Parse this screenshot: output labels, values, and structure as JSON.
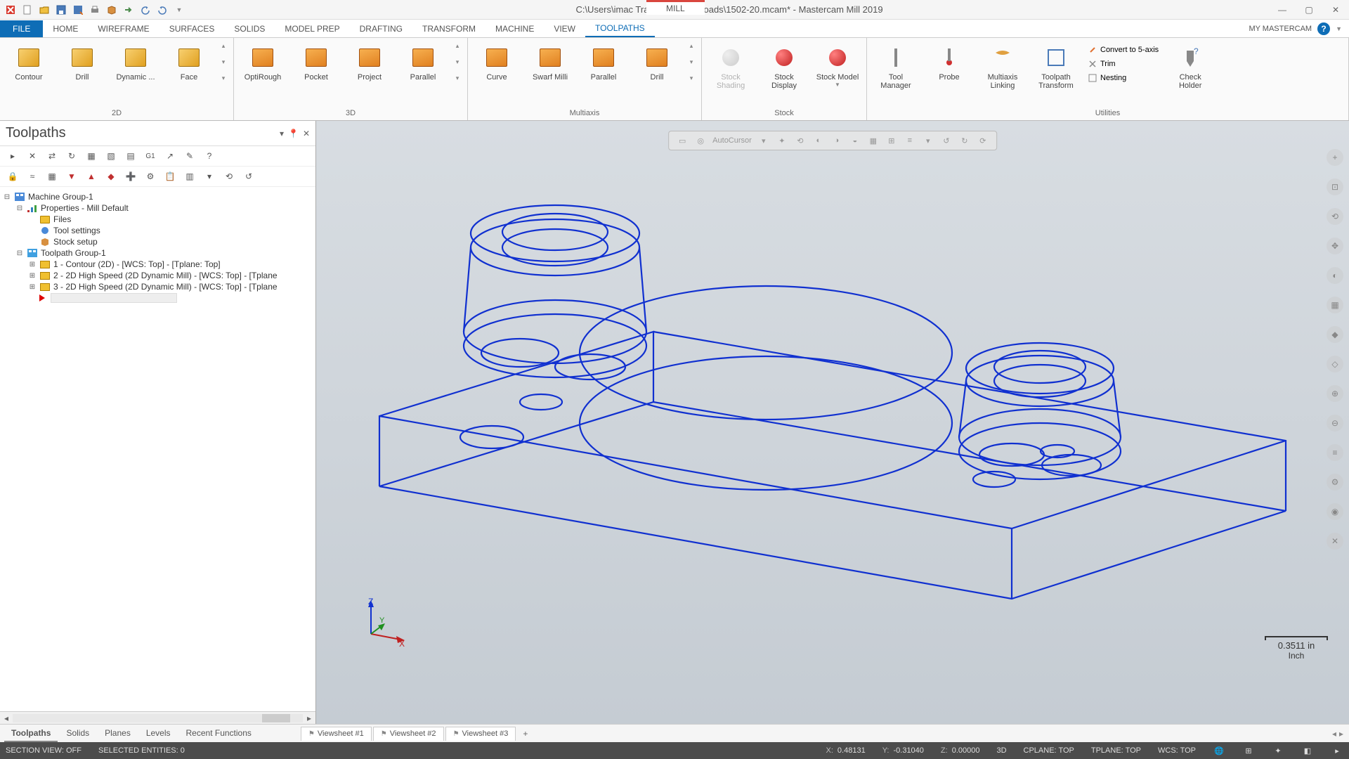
{
  "title_bar": {
    "file_path": "C:\\Users\\imac Training 6\\Downloads\\1502-20.mcam* - Mastercam Mill 2019",
    "context_tab": "MILL"
  },
  "ribbon_tabs": {
    "file": "FILE",
    "items": [
      "HOME",
      "WIREFRAME",
      "SURFACES",
      "SOLIDS",
      "MODEL PREP",
      "DRAFTING",
      "TRANSFORM",
      "MACHINE",
      "VIEW",
      "TOOLPATHS"
    ],
    "active": "TOOLPATHS",
    "my_label": "MY MASTERCAM"
  },
  "ribbon": {
    "group_2d": {
      "label": "2D",
      "contour": "Contour",
      "drill": "Drill",
      "dynamic": "Dynamic ...",
      "face": "Face"
    },
    "group_3d": {
      "label": "3D",
      "optirough": "OptiRough",
      "pocket": "Pocket",
      "project": "Project",
      "parallel": "Parallel"
    },
    "group_multiaxis": {
      "label": "Multiaxis",
      "curve": "Curve",
      "swarf": "Swarf Milli",
      "parallel": "Parallel",
      "drill": "Drill"
    },
    "group_stock": {
      "label": "Stock",
      "shading": "Stock Shading",
      "display": "Stock Display",
      "model": "Stock Model"
    },
    "group_utilities": {
      "label": "Utilities",
      "tool_manager": "Tool Manager",
      "probe": "Probe",
      "multiaxis_link": "Multiaxis Linking",
      "toolpath_transform": "Toolpath Transform",
      "convert_5axis": "Convert to 5-axis",
      "trim": "Trim",
      "nesting": "Nesting",
      "check_holder": "Check Holder"
    }
  },
  "side_panel": {
    "title": "Toolpaths",
    "tree": {
      "machine_group": "Machine Group-1",
      "properties": "Properties - Mill Default",
      "files": "Files",
      "tool_settings": "Tool settings",
      "stock_setup": "Stock setup",
      "toolpath_group": "Toolpath Group-1",
      "op1": "1 - Contour (2D) - [WCS: Top] - [Tplane: Top]",
      "op2": "2 - 2D High Speed (2D Dynamic Mill) - [WCS: Top] - [Tplane",
      "op3": "3 - 2D High Speed (2D Dynamic Mill) - [WCS: Top] - [Tplane"
    }
  },
  "floating_toolbar": {
    "autocursor": "AutoCursor"
  },
  "scale": {
    "value": "0.3511 in",
    "unit": "Inch"
  },
  "bottom_tabs": {
    "left": [
      "Toolpaths",
      "Solids",
      "Planes",
      "Levels",
      "Recent Functions"
    ],
    "active": "Toolpaths",
    "sheets": [
      "Viewsheet #1",
      "Viewsheet #2",
      "Viewsheet #3"
    ]
  },
  "status_bar": {
    "section_view": "SECTION VIEW: OFF",
    "selected": "SELECTED ENTITIES: 0",
    "x_lbl": "X:",
    "x_val": "0.48131",
    "y_lbl": "Y:",
    "y_val": "-0.31040",
    "z_lbl": "Z:",
    "z_val": "0.00000",
    "mode": "3D",
    "cplane": "CPLANE: TOP",
    "tplane": "TPLANE: TOP",
    "wcs": "WCS: TOP"
  }
}
